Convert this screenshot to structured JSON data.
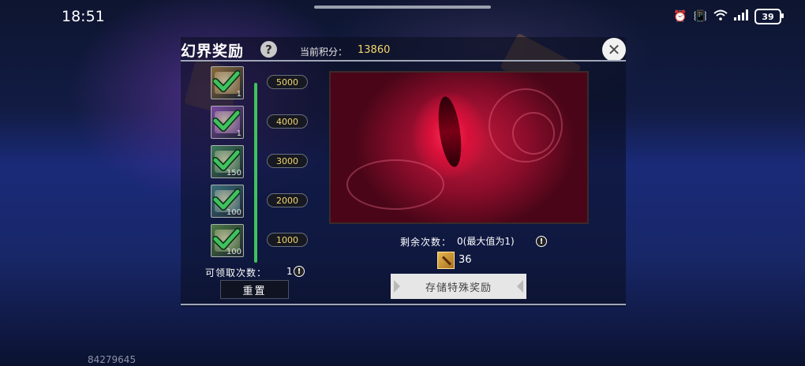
{
  "status_bar": {
    "time": "18:51",
    "battery": "39"
  },
  "panel": {
    "title": "幻界奖励",
    "score_label": "当前积分：",
    "score_value": "13860",
    "tiers": [
      {
        "threshold": "5000",
        "item_count": "1",
        "claimed": true,
        "color": "#8a6a3c"
      },
      {
        "threshold": "4000",
        "item_count": "1",
        "claimed": true,
        "color": "#7a4aa0"
      },
      {
        "threshold": "3000",
        "item_count": "150",
        "claimed": true,
        "color": "#3e7a5a"
      },
      {
        "threshold": "2000",
        "item_count": "100",
        "claimed": true,
        "color": "#3a6f7a"
      },
      {
        "threshold": "1000",
        "item_count": "100",
        "claimed": true,
        "color": "#4c7a44"
      }
    ],
    "progress_fraction": 1.0,
    "claim_label": "可领取次数：",
    "claim_value": "1",
    "reset_label": "重置",
    "remaining_label": "剩余次数：",
    "remaining_value": "0(最大值为1)",
    "cost_value": "36",
    "store_button": "存储特殊奖励"
  },
  "uid": "84279645",
  "colors": {
    "accent_gold": "#f5d66a",
    "check_green": "#3fc25e"
  }
}
